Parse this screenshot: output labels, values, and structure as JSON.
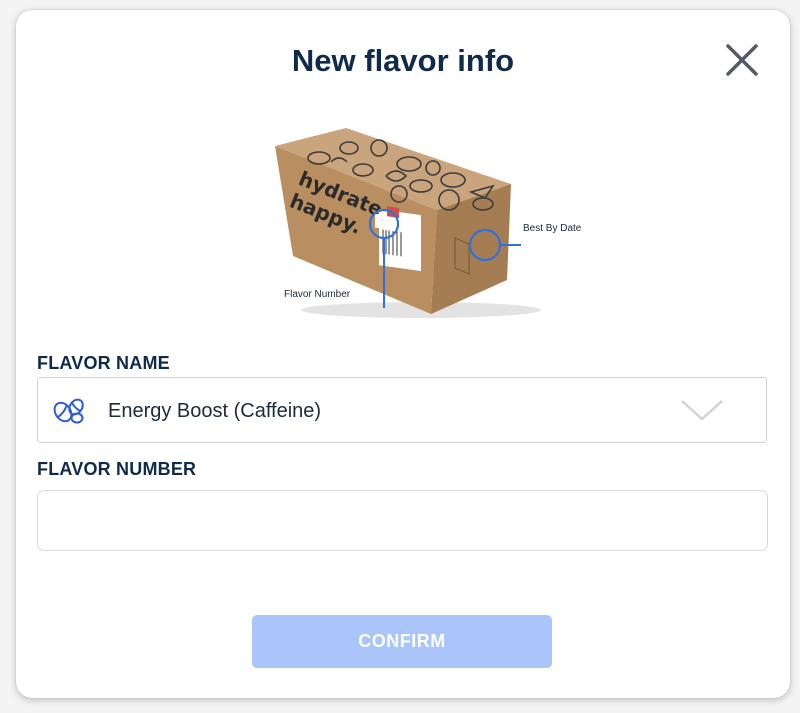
{
  "modal": {
    "title": "New flavor info",
    "close_icon": "close-icon"
  },
  "illustration": {
    "box_logo_text": "hydrate happy.",
    "callout_flavor_number": "Flavor Number",
    "callout_best_by": "Best By Date"
  },
  "form": {
    "flavor_name_label": "FLAVOR NAME",
    "flavor_name_value": "Energy Boost (Caffeine)",
    "flavor_name_icon": "coffee-beans-icon",
    "flavor_number_label": "FLAVOR NUMBER",
    "flavor_number_value": "",
    "flavor_number_placeholder": ""
  },
  "actions": {
    "confirm_label": "CONFIRM"
  },
  "colors": {
    "title": "#0f2a4a",
    "accent_blue": "#3b82f6",
    "confirm_disabled": "#a9c5fb",
    "icon_blue": "#2f5bd3"
  }
}
